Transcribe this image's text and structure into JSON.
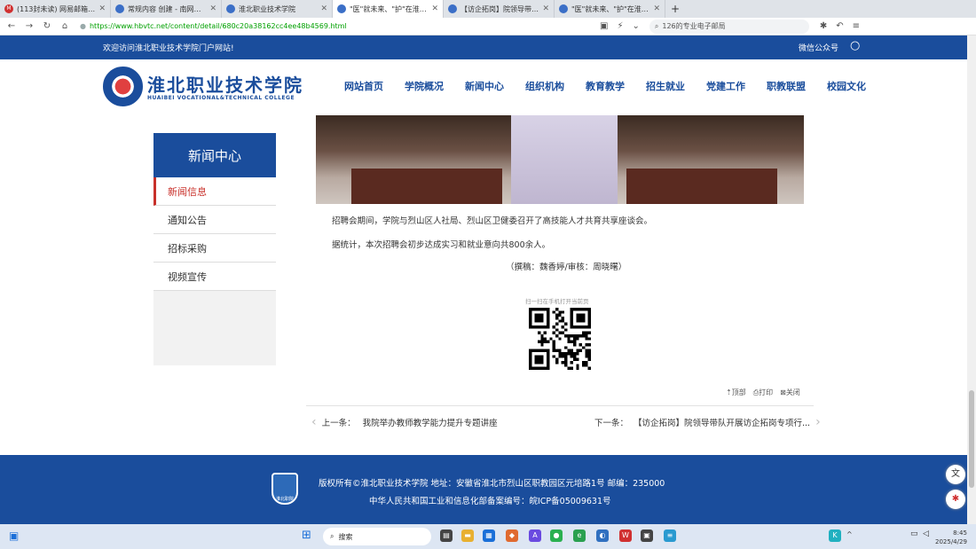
{
  "browser": {
    "tabs": [
      {
        "label": "(113封未读) 网易邮箱6.0版",
        "active": false
      },
      {
        "label": "常规内容 创建 - 南网云政务",
        "active": false
      },
      {
        "label": "淮北职业技术学院",
        "active": false
      },
      {
        "label": "\"医\"就未来、\"护\"在淮北 | 我院",
        "active": true
      },
      {
        "label": "【访企拓岗】院领导带队开展访",
        "active": false
      },
      {
        "label": "\"医\"就未来、\"护\"在淮北 | 我院",
        "active": false
      }
    ],
    "new_tab": "+",
    "url": "https://www.hbvtc.net/content/detail/680c20a38162cc4ee48b4569.html",
    "search_text": "126的专业电子邮局"
  },
  "site": {
    "welcome": "欢迎访问淮北职业技术学院门户网站!",
    "wechat": "微信公众号",
    "school_cn": "淮北职业技术学院",
    "school_en": "HUAIBEI VOCATIONAL&TECHNICAL COLLEGE",
    "nav": [
      "网站首页",
      "学院概况",
      "新闻中心",
      "组织机构",
      "教育教学",
      "招生就业",
      "党建工作",
      "职教联盟",
      "校园文化"
    ]
  },
  "sidebar": {
    "title": "新闻中心",
    "items": [
      "新闻信息",
      "通知公告",
      "招标采购",
      "视频宣传"
    ]
  },
  "article": {
    "p1": "招聘会期间，学院与烈山区人社局、烈山区卫健委召开了高技能人才共育共享座谈会。",
    "p2": "据统计，本次招聘会初步达成实习和就业意向共800余人。",
    "author": "（撰稿：魏香婷/审核：周晓曙）",
    "qr_label": "扫一扫在手机打开当前页",
    "tools": [
      "顶部",
      "打印",
      "关闭"
    ],
    "prev_label": "上一条：",
    "prev_title": "我院举办教师教学能力提升专题讲座",
    "next_label": "下一条：",
    "next_title": "【访企拓岗】院领导带队开展访企拓岗专项行..."
  },
  "footer": {
    "line1": "版权所有©淮北职业技术学院 地址：安徽省淮北市烈山区职教园区元培路1号 邮编：235000",
    "line2": "中华人民共和国工业和信息化部备案编号：皖ICP备05009631号",
    "badge": "淮北职院"
  },
  "taskbar": {
    "search": "搜索",
    "time": "8:45",
    "date": "2025/4/29"
  }
}
